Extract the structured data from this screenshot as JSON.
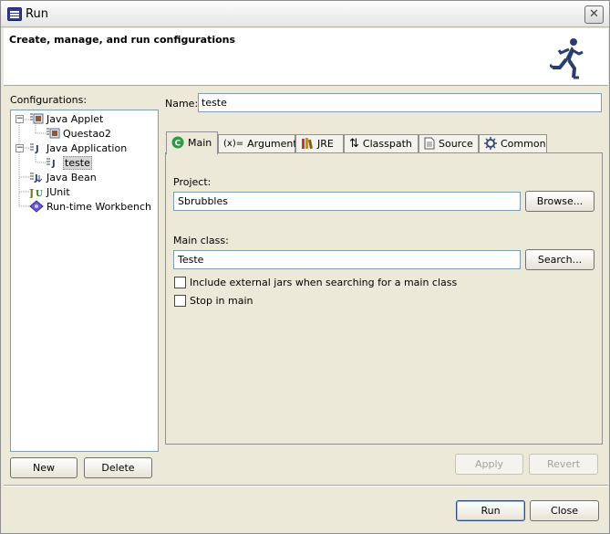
{
  "window": {
    "title": "Run"
  },
  "banner": {
    "title": "Create, manage, and run configurations"
  },
  "configurations": {
    "label": "Configurations:",
    "tree": [
      {
        "label": "Java Applet",
        "icon": "java-applet-icon",
        "level": 0,
        "expanded": true
      },
      {
        "label": "Questao2",
        "icon": "applet-config-icon",
        "level": 1
      },
      {
        "label": "Java Application",
        "icon": "java-application-icon",
        "level": 0,
        "expanded": true
      },
      {
        "label": "teste",
        "icon": "application-config-icon",
        "level": 1,
        "selected": true
      },
      {
        "label": "Java Bean",
        "icon": "java-bean-icon",
        "level": 0
      },
      {
        "label": "JUnit",
        "icon": "junit-icon",
        "level": 0
      },
      {
        "label": "Run-time Workbench",
        "icon": "workbench-icon",
        "level": 0
      }
    ],
    "new_label": "New",
    "delete_label": "Delete"
  },
  "name": {
    "label": "Name:",
    "value": "teste"
  },
  "tabs": [
    {
      "label": "Main",
      "icon": "main-c-icon",
      "active": true
    },
    {
      "label": "Arguments",
      "icon": "arguments-icon"
    },
    {
      "label": "JRE",
      "icon": "jre-icon"
    },
    {
      "label": "Classpath",
      "icon": "classpath-icon"
    },
    {
      "label": "Source",
      "icon": "source-icon"
    },
    {
      "label": "Common",
      "icon": "common-icon"
    }
  ],
  "main_tab": {
    "project_label": "Project:",
    "project_value": "Sbrubbles",
    "browse_label": "Browse...",
    "main_class_label": "Main class:",
    "main_class_value": "Teste",
    "search_label": "Search...",
    "include_external_label": "Include external jars when searching for a main class",
    "include_external_checked": false,
    "stop_in_main_label": "Stop in main",
    "stop_in_main_checked": false
  },
  "actions": {
    "apply_label": "Apply",
    "revert_label": "Revert",
    "run_label": "Run",
    "close_label": "Close"
  },
  "colors": {
    "dialog_bg": "#ece9d8",
    "border_blue": "#7f9db9",
    "main_icon_green": "#2f9a46"
  }
}
